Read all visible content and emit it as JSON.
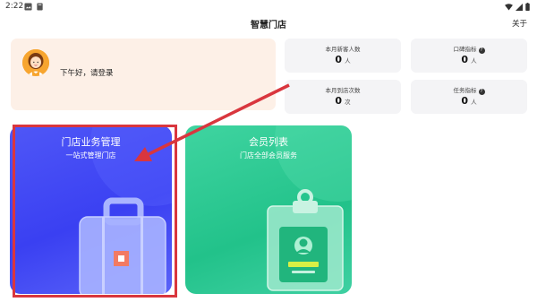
{
  "status_bar": {
    "time": "2:22"
  },
  "header": {
    "title": "智慧门店",
    "about": "关于"
  },
  "welcome": {
    "greeting": "下午好，请登录"
  },
  "stats": [
    {
      "label": "本月新客人数",
      "value": "0",
      "unit": "人",
      "has_help": false
    },
    {
      "label": "口碑指标",
      "value": "0",
      "unit": "人",
      "has_help": true
    },
    {
      "label": "本月到店次数",
      "value": "0",
      "unit": "次",
      "has_help": false
    },
    {
      "label": "任务指标",
      "value": "0",
      "unit": "人",
      "has_help": true
    }
  ],
  "cards": [
    {
      "title": "门店业务管理",
      "subtitle": "一站式管理门店",
      "icon": "briefcase-icon",
      "color": "#4a51f5"
    },
    {
      "title": "会员列表",
      "subtitle": "门店全部会员服务",
      "icon": "member-card-icon",
      "color": "#2ccb92"
    }
  ],
  "colors": {
    "highlight": "#d9363e",
    "welcome_bg": "#fdf0e7",
    "stat_bg": "#f4f4f6"
  },
  "help_glyph": "?"
}
